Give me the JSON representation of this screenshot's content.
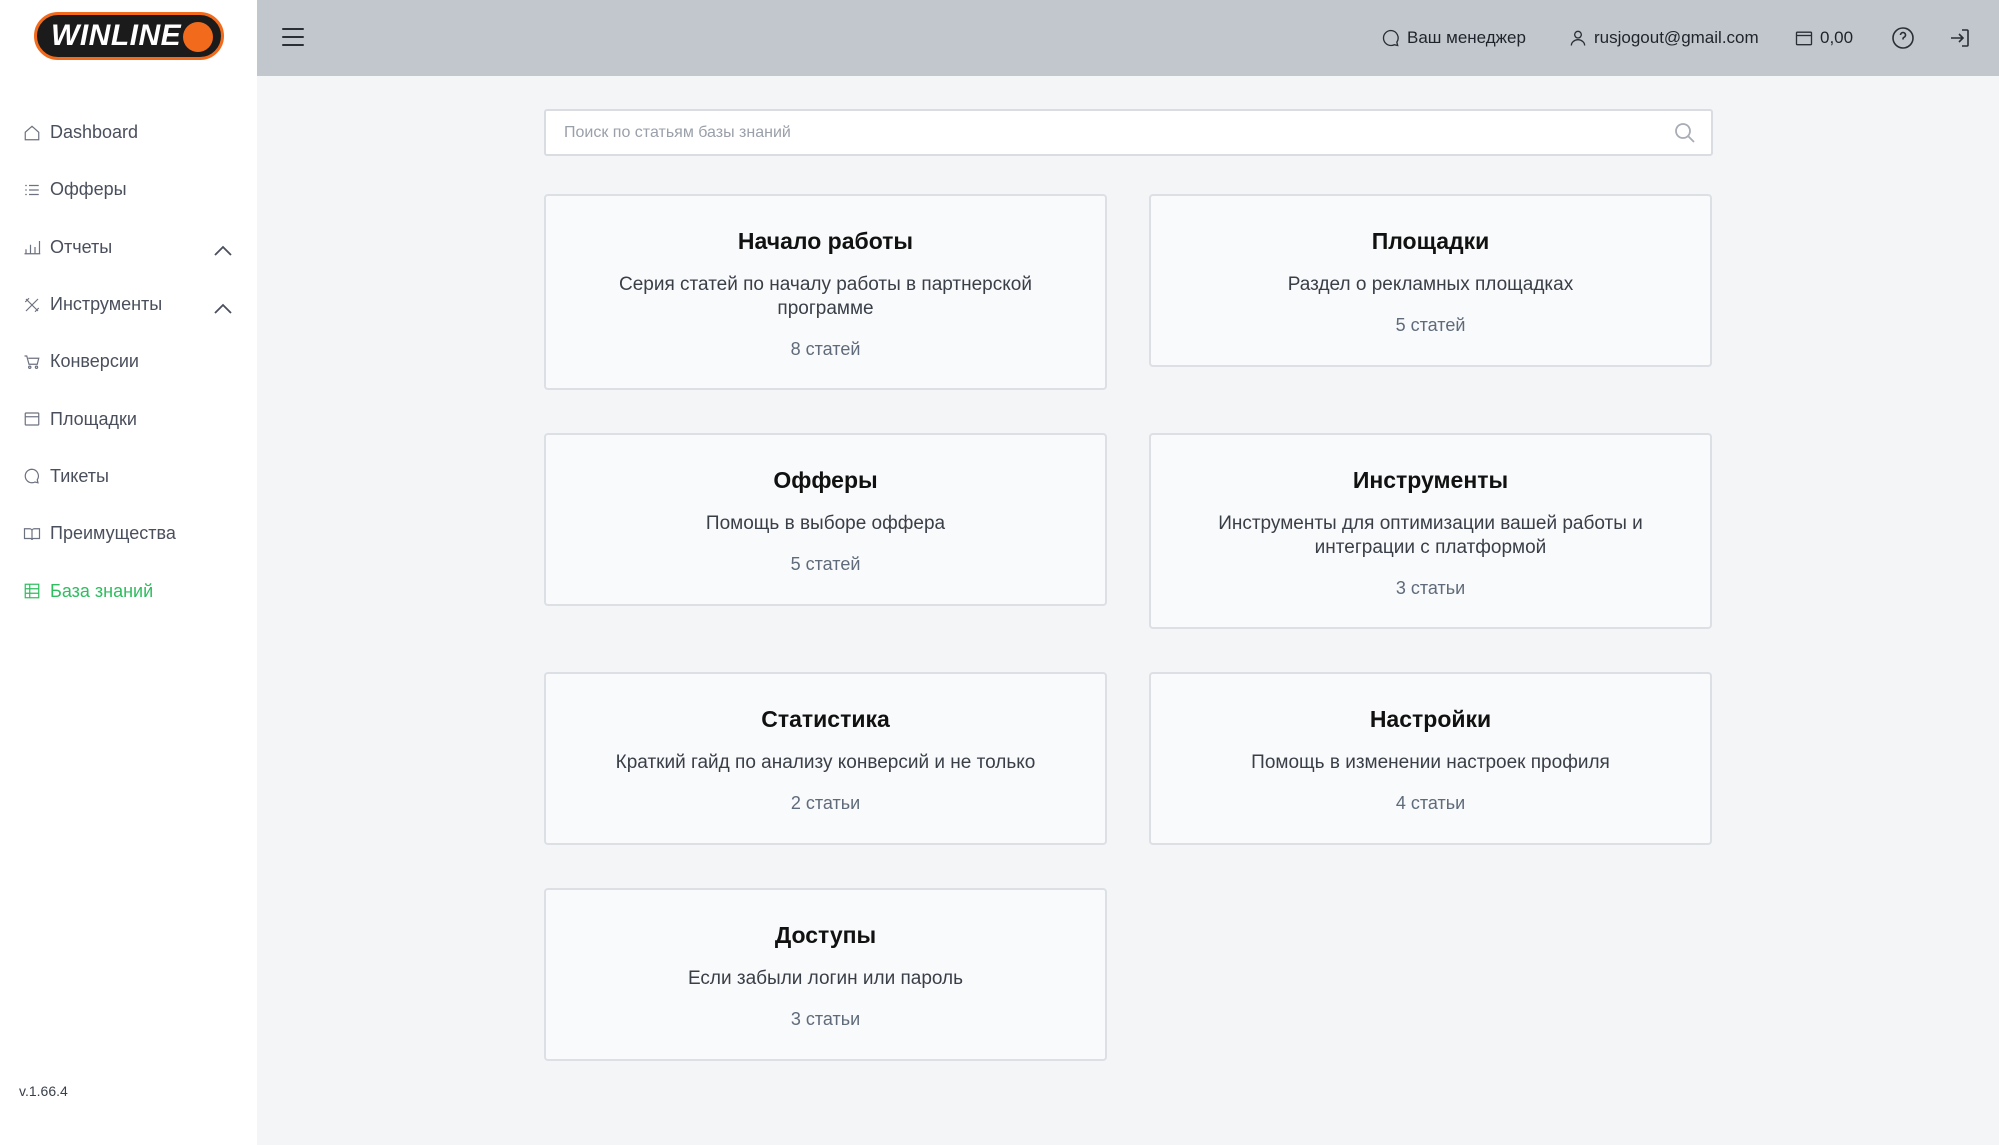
{
  "brand": {
    "name": "WINLINE",
    "accent": "#f26a1b",
    "active_color": "#2ebd5f"
  },
  "sidebar": {
    "items": [
      {
        "label": "Dashboard",
        "icon": "home-icon"
      },
      {
        "label": "Офферы",
        "icon": "list-icon"
      },
      {
        "label": "Отчеты",
        "icon": "bar-chart-icon",
        "expandable": true
      },
      {
        "label": "Инструменты",
        "icon": "tools-icon",
        "expandable": true
      },
      {
        "label": "Конверсии",
        "icon": "cart-icon"
      },
      {
        "label": "Площадки",
        "icon": "browser-window-icon"
      },
      {
        "label": "Тикеты",
        "icon": "chat-bubble-icon"
      },
      {
        "label": "Преимущества",
        "icon": "book-icon"
      },
      {
        "label": "База знаний",
        "icon": "table-icon",
        "active": true
      }
    ],
    "version": "v.1.66.4"
  },
  "header": {
    "manager_label": "Ваш менеджер",
    "user_email": "rusjogout@gmail.com",
    "balance": "0,00"
  },
  "search": {
    "placeholder": "Поиск по статьям базы знаний",
    "value": ""
  },
  "cards": [
    {
      "title": "Начало работы",
      "description": "Серия статей по началу работы в партнерской программе",
      "count": "8 статей"
    },
    {
      "title": "Площадки",
      "description": "Раздел о рекламных площадках",
      "count": "5 статей"
    },
    {
      "title": "Офферы",
      "description": "Помощь в выборе оффера",
      "count": "5 статей"
    },
    {
      "title": "Инструменты",
      "description": "Инструменты для оптимизации вашей работы и интеграции с платформой",
      "count": "3 статьи"
    },
    {
      "title": "Статистика",
      "description": "Краткий гайд по анализу конверсий и не только",
      "count": "2 статьи"
    },
    {
      "title": "Настройки",
      "description": "Помощь в изменении настроек профиля",
      "count": "4 статьи"
    },
    {
      "title": "Доступы",
      "description": "Если забыли логин или пароль",
      "count": "3 статьи"
    }
  ]
}
